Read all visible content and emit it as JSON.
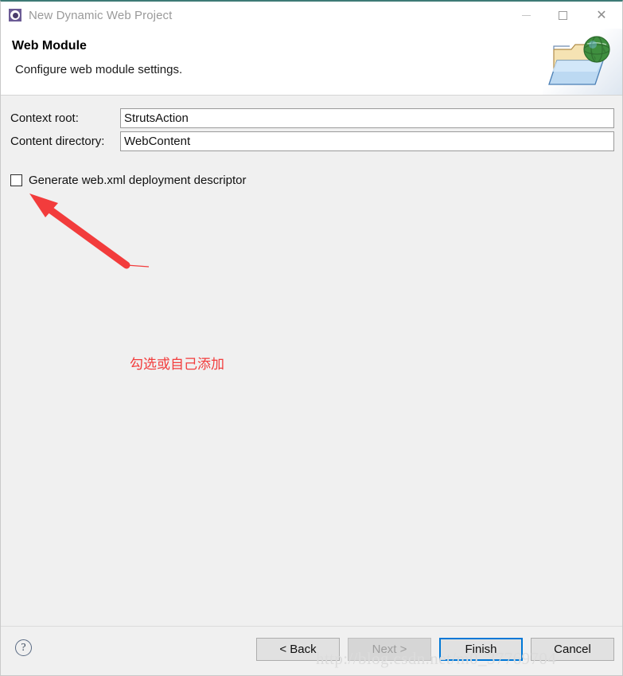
{
  "window": {
    "title": "New Dynamic Web Project",
    "icon": "eclipse-project-icon",
    "controls": {
      "minimize": "minimize-icon",
      "maximize": "maximize-icon",
      "close": "close-icon"
    }
  },
  "header": {
    "heading": "Web Module",
    "description": "Configure web module settings.",
    "banner_icon": "folder-globe-icon"
  },
  "form": {
    "context_root": {
      "label": "Context root:",
      "value": "StrutsAction",
      "placeholder": ""
    },
    "content_directory": {
      "label": "Content directory:",
      "value": "WebContent",
      "placeholder": ""
    },
    "generate_webxml": {
      "label": "Generate web.xml deployment descriptor",
      "checked": false
    }
  },
  "annotation": {
    "text": "勾选或自己添加",
    "arrow_color": "#f23c3c"
  },
  "footer": {
    "help": "?",
    "buttons": [
      {
        "label": "< Back",
        "state": "enabled"
      },
      {
        "label": "Next >",
        "state": "disabled"
      },
      {
        "label": "Finish",
        "state": "default"
      },
      {
        "label": "Cancel",
        "state": "enabled"
      }
    ]
  },
  "watermark": {
    "text": "http://blog.csdn.net/m0_37769704"
  },
  "colors": {
    "accent_top_border": "#3d7a75",
    "default_button_border": "#0078d7",
    "dialog_background": "#f0f0f0",
    "annotation_red": "#f23c3c"
  }
}
